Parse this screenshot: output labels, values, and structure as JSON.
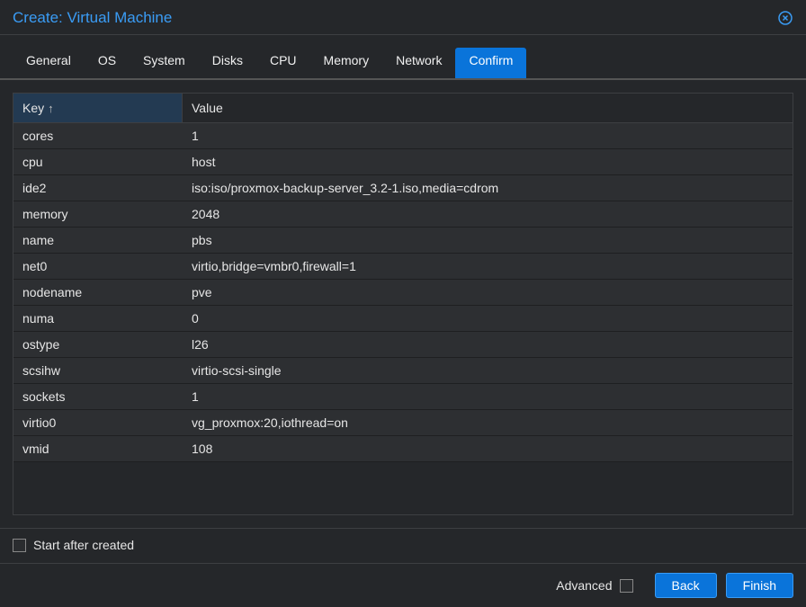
{
  "window": {
    "title": "Create: Virtual Machine"
  },
  "tabs": [
    {
      "label": "General"
    },
    {
      "label": "OS"
    },
    {
      "label": "System"
    },
    {
      "label": "Disks"
    },
    {
      "label": "CPU"
    },
    {
      "label": "Memory"
    },
    {
      "label": "Network"
    },
    {
      "label": "Confirm",
      "active": true
    }
  ],
  "table": {
    "headers": {
      "key": "Key",
      "value": "Value"
    },
    "sort_icon": "↑",
    "rows": [
      {
        "key": "cores",
        "value": "1"
      },
      {
        "key": "cpu",
        "value": "host"
      },
      {
        "key": "ide2",
        "value": "iso:iso/proxmox-backup-server_3.2-1.iso,media=cdrom"
      },
      {
        "key": "memory",
        "value": "2048"
      },
      {
        "key": "name",
        "value": "pbs"
      },
      {
        "key": "net0",
        "value": "virtio,bridge=vmbr0,firewall=1"
      },
      {
        "key": "nodename",
        "value": "pve"
      },
      {
        "key": "numa",
        "value": "0"
      },
      {
        "key": "ostype",
        "value": "l26"
      },
      {
        "key": "scsihw",
        "value": "virtio-scsi-single"
      },
      {
        "key": "sockets",
        "value": "1"
      },
      {
        "key": "virtio0",
        "value": "vg_proxmox:20,iothread=on"
      },
      {
        "key": "vmid",
        "value": "108"
      }
    ]
  },
  "start_after_label": "Start after created",
  "footer": {
    "advanced_label": "Advanced",
    "back_label": "Back",
    "finish_label": "Finish"
  }
}
